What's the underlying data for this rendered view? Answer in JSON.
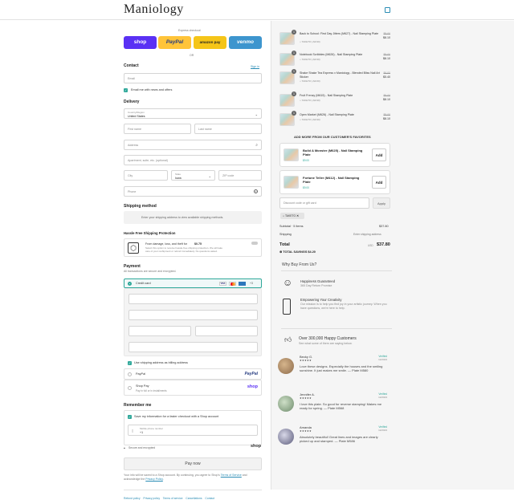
{
  "header": {
    "logo": "Maniology",
    "cart_icon": "shopping-bag-icon"
  },
  "express": {
    "title": "Express checkout",
    "buttons": [
      {
        "label": "shop",
        "color": "#5a31f4"
      },
      {
        "label": "PayPal",
        "color": "#ffc439"
      },
      {
        "label": "amazon pay",
        "color": "#f5c518"
      },
      {
        "label": "venmo",
        "color": "#3d95ce"
      }
    ],
    "or": "OR"
  },
  "contact": {
    "title": "Contact",
    "signin": "Sign in",
    "email_placeholder": "Email",
    "news_label": "Email me with news and offers"
  },
  "delivery": {
    "title": "Delivery",
    "country_label": "Country/Region",
    "country_value": "United States",
    "first_name": "First name",
    "last_name": "Last name",
    "address": "Address",
    "apartment": "Apartment, suite, etc. (optional)",
    "city": "City",
    "state_label": "State",
    "state_value": "Iowa",
    "zip": "ZIP code",
    "phone": "Phone"
  },
  "shipping": {
    "title": "Shipping method",
    "message": "Enter your shipping address to view available shipping methods."
  },
  "protection": {
    "title": "Hassle Free Shipping Protection",
    "line1": "From damage, loss, and theft for",
    "price": "$0.75",
    "line2": "Select this option to receive hassle-free shipping protection. We will take",
    "line3": "care of your reshipment or refund immediately. No questions asked."
  },
  "payment": {
    "title": "Payment",
    "subtitle": "All transactions are secure and encrypted.",
    "credit_card": "Credit card",
    "card_more": "+3",
    "billing_label": "Use shipping address as billing address",
    "paypal": "PayPal",
    "paypal_logo": "PayPal",
    "shoppay": "Shop Pay",
    "shoppay_sub": "Pay in full or in installments",
    "shoppay_logo": "shop"
  },
  "remember": {
    "title": "Remember me",
    "save_label": "Save my information for a faster checkout with a Shop account",
    "phone_label": "Mobile phone number",
    "phone_prefix": "+1",
    "secure": "Secure and encrypted",
    "shop_logo": "shop"
  },
  "pay_now": "Pay now",
  "legal": {
    "text1": "Your info will be saved to a Shop account. By continuing, you agree to Shop's",
    "terms": "Terms of Service",
    "text2": "and acknowledge the",
    "privacy": "Privacy Policy",
    "end": "."
  },
  "footer": [
    "Refund policy",
    "Privacy policy",
    "Terms of service",
    "Cancellations",
    "Contact"
  ],
  "cart": {
    "items": [
      {
        "name": "Back to School: First Day Jitters (M627) - Nail Stamping Plate",
        "code": "TAKETO (-$0.90)",
        "old": "$9.00",
        "new": "$8.10",
        "qty": "1"
      },
      {
        "name": "Notebook Scribbles (M626) - Nail Stamping Plate",
        "code": "TAKETO (-$0.90)",
        "old": "$9.00",
        "new": "$8.10",
        "qty": "1"
      },
      {
        "name": "Shake Shake Tea Express x Maniology - Blended Bliss Nail Art Sticker",
        "code": "TAKETO (-$0.60)",
        "old": "$6.00",
        "new": "$5.40",
        "qty": "1"
      },
      {
        "name": "Fruit Frenzy (M615) - Nail Stamping Plate",
        "code": "TAKETO (-$0.90)",
        "old": "$9.00",
        "new": "$8.10",
        "qty": "1"
      },
      {
        "name": "Open Market (M626) - Nail Stamping Plate",
        "code": "TAKETO (-$0.90)",
        "old": "$9.00",
        "new": "$8.10",
        "qty": "1"
      }
    ]
  },
  "favorites": {
    "title": "ADD MORE FROM OUR CUSTOMER'S FAVORITES",
    "items": [
      {
        "name": "Build A Monster (M625) - Nail Stamping Plate",
        "price": "$9.00",
        "add": "Add"
      },
      {
        "name": "Fortune Teller (M412) - Nail Stamping Plate",
        "price": "$9.00",
        "add": "Add"
      }
    ]
  },
  "discount": {
    "placeholder": "Discount code or gift card",
    "apply": "Apply",
    "tag": "TAKETO"
  },
  "summary": {
    "subtotal_label": "Subtotal · 5 items",
    "subtotal": "$37.80",
    "shipping_label": "Shipping",
    "shipping": "Enter shipping address",
    "total_label": "Total",
    "currency": "USD",
    "total": "$37.80",
    "savings": "TOTAL SAVINGS",
    "savings_value": "$4.20"
  },
  "why": {
    "title": "Why Buy From Us?",
    "items": [
      {
        "title": "Happiness Guaranteed",
        "desc": "365 Day Return Promise"
      },
      {
        "title": "Empowering Your Creativity",
        "desc": "Our mission is to help you find joy in your artistic journey. When you have questions, we're here to help."
      }
    ]
  },
  "customers": {
    "title": "Over 300,000 Happy Customers",
    "subtitle": "See what some of them are saying below."
  },
  "reviews": [
    {
      "name": "Becky G.",
      "stars": "★★★★★",
      "verified": "Verified",
      "date": "12/2023",
      "text": "Love these designs. Especially the houses and the smiling sunshine. It just makes me smile. — Plate M580"
    },
    {
      "name": "Jennifer A.",
      "stars": "★★★★★",
      "verified": "Verified",
      "date": "12/2023",
      "text": "I love this plate. So good for reverse stamping! Makes me ready for spring. — Plate M568"
    },
    {
      "name": "Amanda",
      "stars": "★★★★★",
      "verified": "Verified",
      "date": "12/2023",
      "text": "Absolutely beautiful! Great lines and images are clearly picked up and stamped. — Plate M586"
    }
  ]
}
